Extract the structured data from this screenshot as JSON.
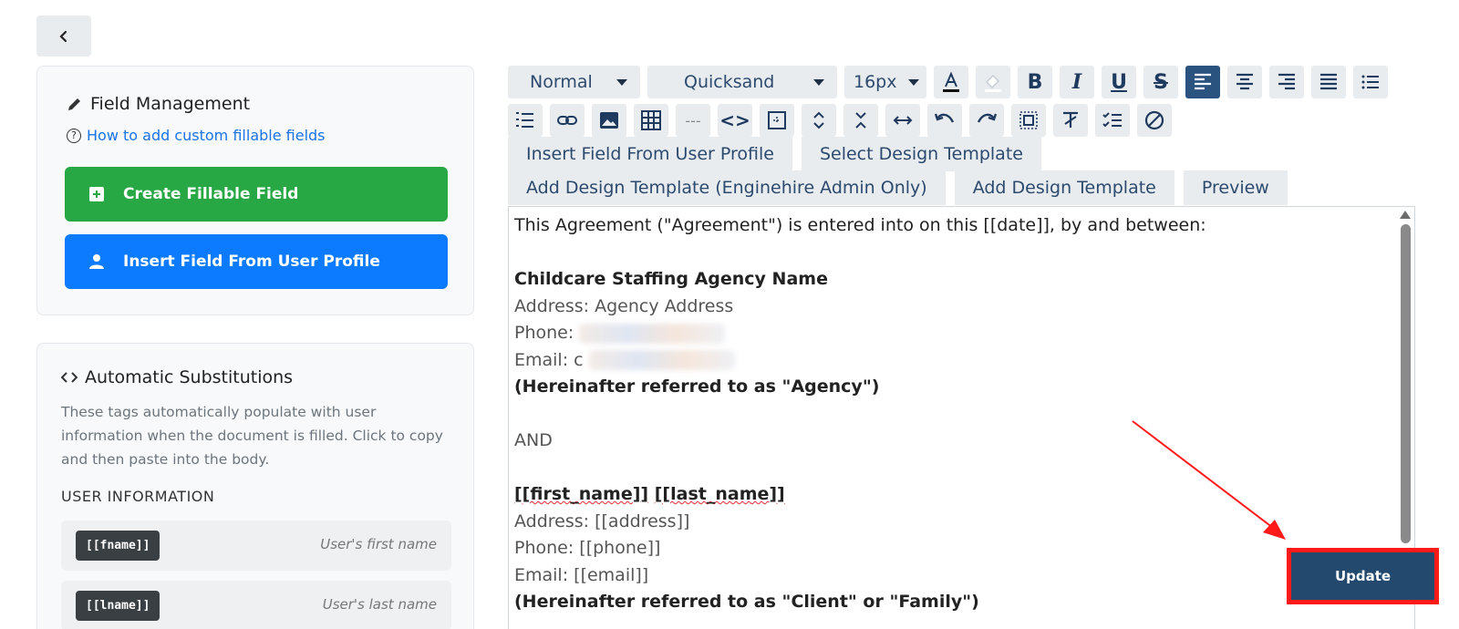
{
  "field_management": {
    "title": "Field Management",
    "help_link": "How to add custom fillable fields",
    "create_button": "Create Fillable Field",
    "insert_button": "Insert Field From User Profile"
  },
  "substitutions": {
    "title": "Automatic Substitutions",
    "description": "These tags automatically populate with user information when the document is filled. Click to copy and then paste into the body.",
    "section_label": "USER INFORMATION",
    "tags": [
      {
        "code": "[[fname]]",
        "desc": "User's first name"
      },
      {
        "code": "[[lname]]",
        "desc": "User's last name"
      }
    ]
  },
  "toolbar": {
    "format": "Normal",
    "font": "Quicksand",
    "size": "16px",
    "bold_label": "B",
    "italic_label": "I",
    "underline_label": "U",
    "strike_label": "S",
    "hr_label": "---",
    "code_label": "<>"
  },
  "tabs": {
    "row1": [
      "Insert Field From User Profile",
      "Select Design Template"
    ],
    "row2": [
      "Add Design Template (Enginehire Admin Only)",
      "Add Design Template",
      "Preview"
    ]
  },
  "editor": {
    "line1": "This Agreement (\"Agreement\") is entered into on this [[date]], by and between:",
    "agency_name": "Childcare Staffing Agency Name",
    "agency_address": "Address: Agency Address",
    "agency_phone_label": "Phone:",
    "agency_email_label": "Email: c",
    "agency_ref": "(Hereinafter referred to as \"Agency\")",
    "and": "AND",
    "client_name_first": "[[first_name]]",
    "client_name_last": "[[last_name]]",
    "client_address": "Address: [[address]]",
    "client_phone": "Phone: [[phone]]",
    "client_email": "Email: [[email]]",
    "client_ref": "(Hereinafter referred to as \"Client\" or \"Family\")"
  },
  "update_button": "Update",
  "colors": {
    "green": "#28a745",
    "blue": "#0d7bff",
    "navy": "#24496e",
    "highlight": "#ff1a1a"
  }
}
